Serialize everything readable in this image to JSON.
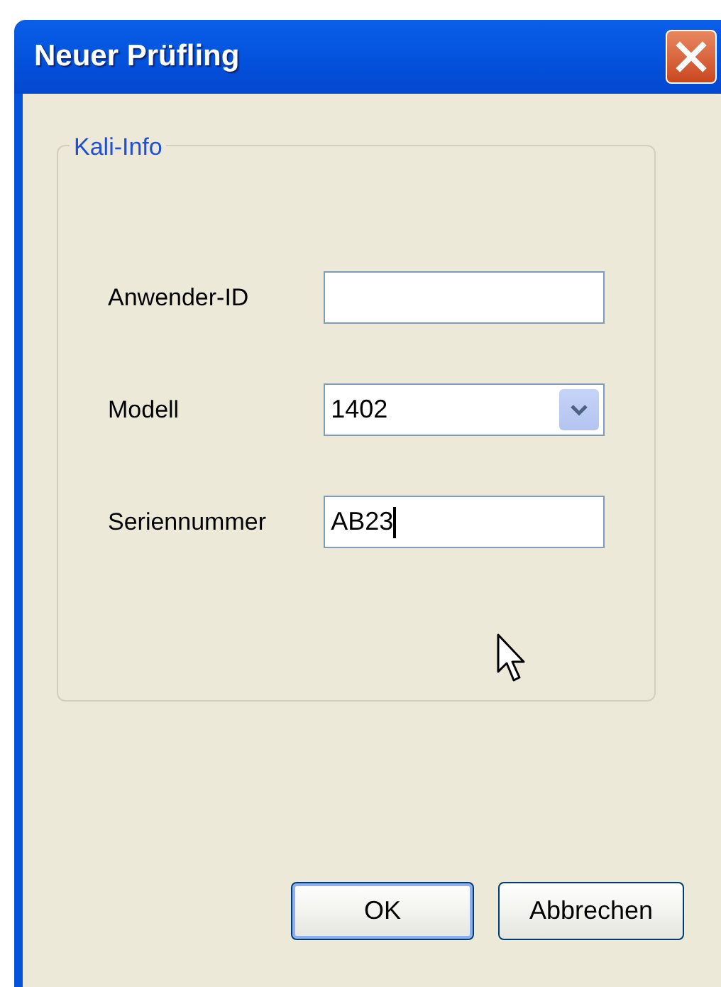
{
  "window": {
    "title": "Neuer Prüfling"
  },
  "group": {
    "title": "Kali-Info"
  },
  "fields": [
    {
      "label": "Anwender-ID",
      "kind": "text",
      "focused": false
    },
    {
      "label": "Modell",
      "kind": "dropdown",
      "value": "1402",
      "focused": false
    },
    {
      "label": "Seriennummer",
      "kind": "text",
      "value": "AB23",
      "focused": true
    }
  ],
  "buttons": [
    {
      "label": "OK",
      "default": true
    },
    {
      "label": "Abbrechen",
      "default": false
    }
  ]
}
